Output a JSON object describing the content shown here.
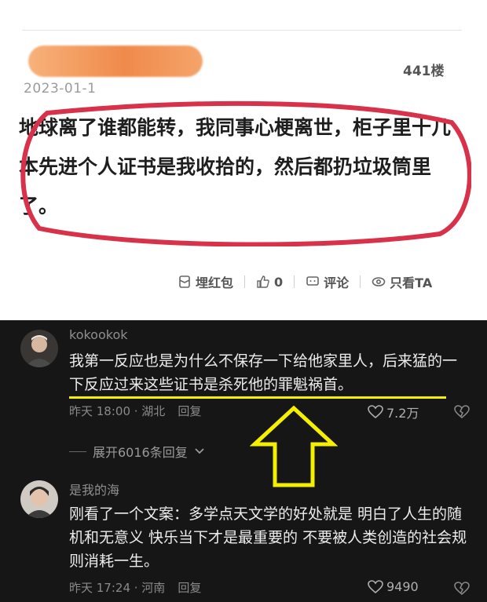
{
  "post": {
    "date": "2023-01-1",
    "floor": "441楼",
    "text": "地球离了谁都能转，我同事心梗离世，柜子里十几本先进个人证书是我收拾的，然后都扔垃圾筒里了。",
    "actions": [
      {
        "label": "埋红包",
        "icon": "red-packet-icon"
      },
      {
        "label": "0",
        "icon": "thumbs-up-icon"
      },
      {
        "label": "评论",
        "icon": "comment-icon"
      },
      {
        "label": "只看TA",
        "icon": "eye-icon"
      }
    ]
  },
  "comments": [
    {
      "username": "kokookok",
      "text": "我第一反应也是为什么不保存一下给他家里人，后来猛的一下反应过来这些证书是杀死他的罪魁祸首。",
      "time": "昨天 18:00 · 湖北",
      "reply": "回复",
      "likes": "7.2万"
    },
    {
      "username": "是我的海",
      "text": "刚看了一个文案：多学点天文学的好处就是 明白了人生的随机和无意义 快乐当下才是最重要的 不要被人类创造的社会规则消耗一生。",
      "time": "昨天 17:24 · 河南",
      "reply": "回复",
      "likes": "9490"
    }
  ],
  "expand_replies": "展开6016条回复",
  "colors": {
    "highlight": "#f4f000",
    "ellipse": "#d8324a",
    "dark_bg": "#161616"
  }
}
